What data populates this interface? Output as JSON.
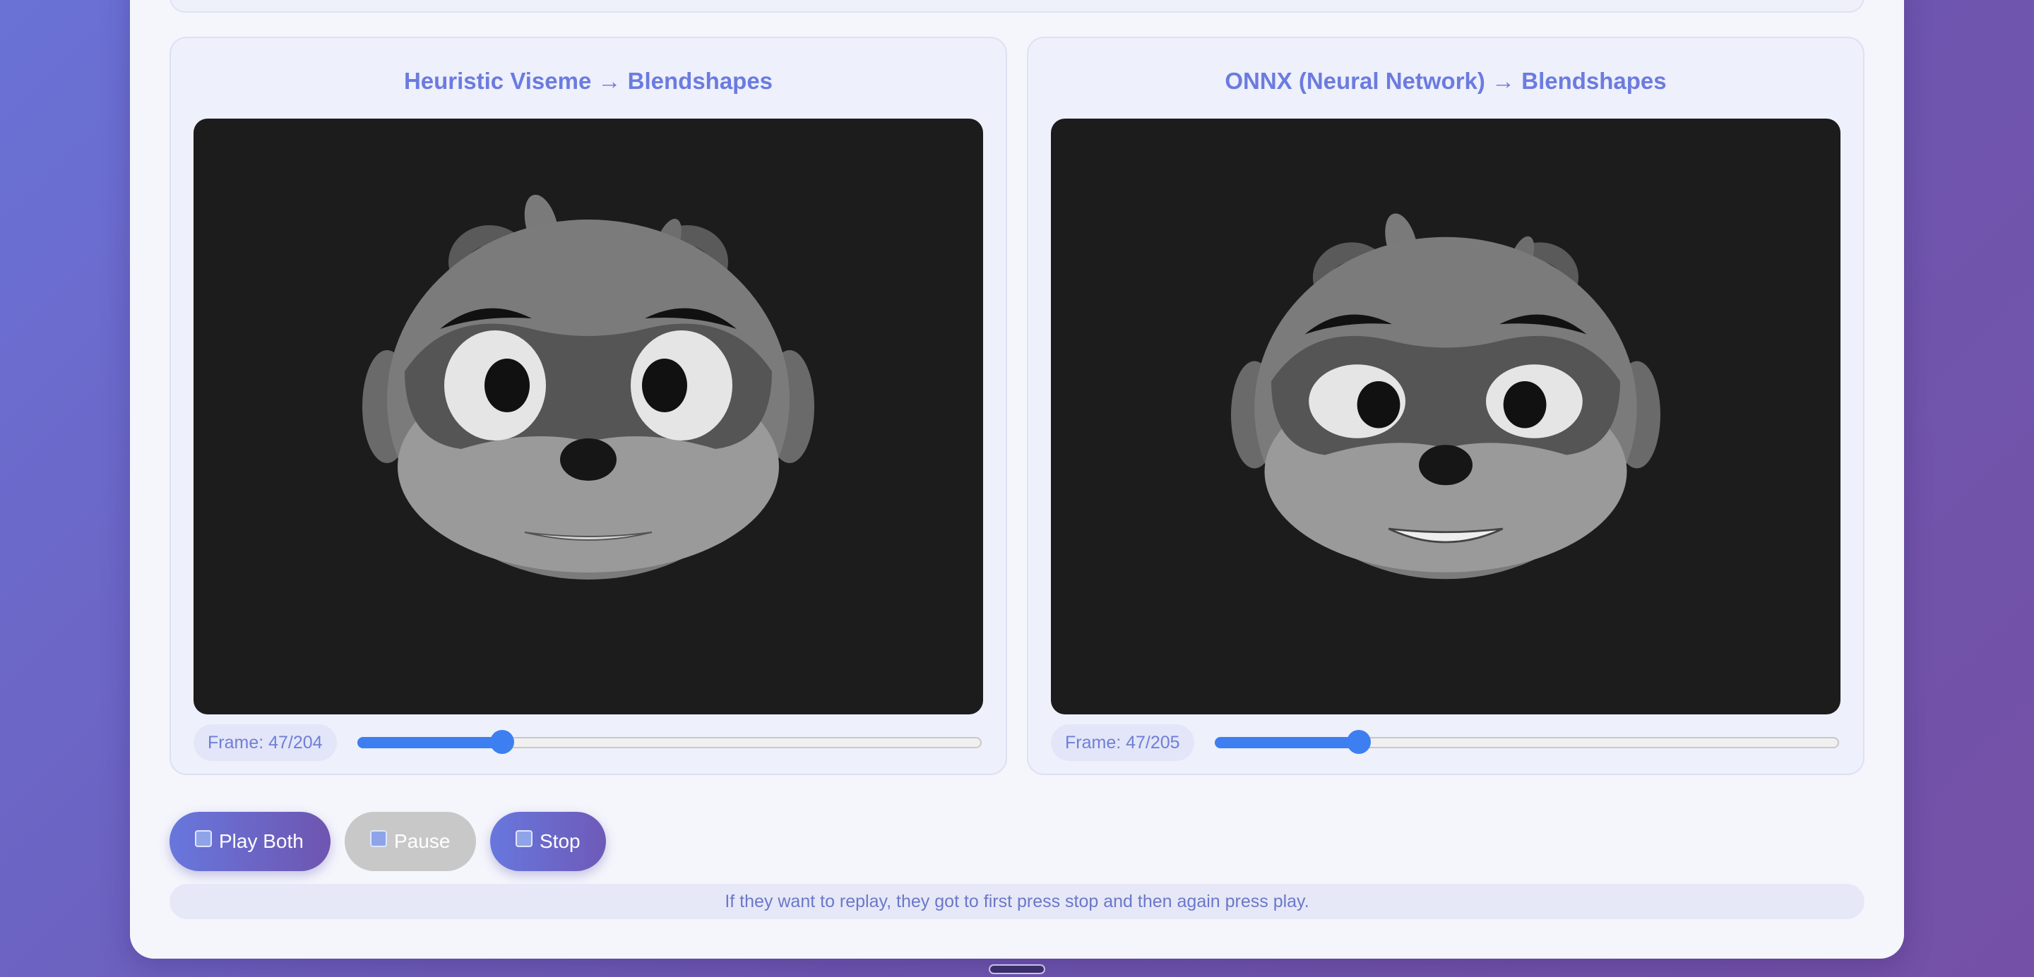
{
  "panels": [
    {
      "title": "Heuristic Viseme → Blendshapes",
      "frame_label": "Frame: 47/204",
      "frame_current": 47,
      "frame_total": 204
    },
    {
      "title": "ONNX (Neural Network) → Blendshapes",
      "frame_label": "Frame: 47/205",
      "frame_current": 47,
      "frame_total": 205
    }
  ],
  "controls": {
    "play_label": "Play Both",
    "pause_label": "Pause",
    "stop_label": "Stop"
  },
  "hint": "If they want to replay, they got to first press stop and then again press play.",
  "colors": {
    "accent": "#6b7be0",
    "slider": "#3d7ff0",
    "viewport_bg": "#1c1c1c"
  }
}
